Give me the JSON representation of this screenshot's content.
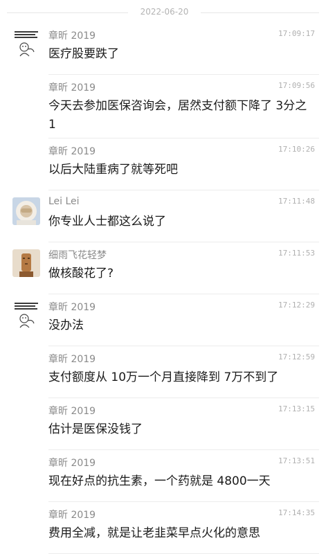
{
  "date_divider": "2022-06-20",
  "messages": [
    {
      "sender": "章昕 2019",
      "time": "17:09:17",
      "text": "医疗股要跌了",
      "avatar": "meme"
    },
    {
      "sender": "章昕 2019",
      "time": "17:09:56",
      "text": "今天去参加医保咨询会，居然支付额下降了 3分之1",
      "avatar": ""
    },
    {
      "sender": "章昕 2019",
      "time": "17:10:26",
      "text": "以后大陆重病了就等死吧",
      "avatar": ""
    },
    {
      "sender": "Lei Lei",
      "time": "17:11:48",
      "text": "你专业人士都这么说了",
      "avatar": "astronaut"
    },
    {
      "sender": "细雨飞花轻梦",
      "time": "17:11:53",
      "text": "做核酸花了?",
      "avatar": "statue"
    },
    {
      "sender": "章昕 2019",
      "time": "17:12:29",
      "text": "没办法",
      "avatar": "meme"
    },
    {
      "sender": "章昕 2019",
      "time": "17:12:59",
      "text": "支付额度从 10万一个月直接降到 7万不到了",
      "avatar": ""
    },
    {
      "sender": "章昕 2019",
      "time": "17:13:15",
      "text": "估计是医保没钱了",
      "avatar": ""
    },
    {
      "sender": "章昕 2019",
      "time": "17:13:51",
      "text": "现在好点的抗生素，一个药就是 4800一天",
      "avatar": ""
    },
    {
      "sender": "章昕 2019",
      "time": "17:14:35",
      "text": "费用全减，就是让老韭菜早点火化的意思",
      "avatar": ""
    }
  ]
}
